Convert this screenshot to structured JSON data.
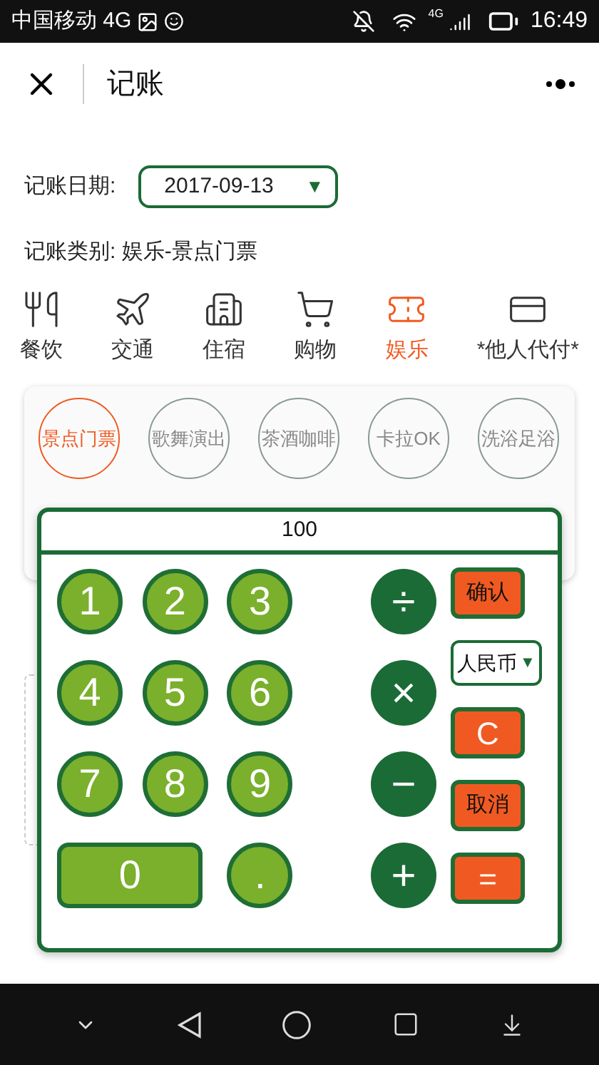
{
  "status_bar": {
    "carrier": "中国移动 4G",
    "network": "4G",
    "time": "16:49"
  },
  "header": {
    "title": "记账"
  },
  "date": {
    "label": "记账日期:",
    "value": "2017-09-13",
    "caret": "▼"
  },
  "category_line": "记账类别: 娱乐-景点门票",
  "categories": [
    {
      "label": "餐饮",
      "kind": "dining",
      "selected": false
    },
    {
      "label": "交通",
      "kind": "transport",
      "selected": false
    },
    {
      "label": "住宿",
      "kind": "hotel",
      "selected": false
    },
    {
      "label": "购物",
      "kind": "shopping",
      "selected": false
    },
    {
      "label": "娱乐",
      "kind": "ticket",
      "selected": true
    },
    {
      "label": "*他人代付*",
      "kind": "card",
      "selected": false
    }
  ],
  "subcategories": [
    {
      "label": "景点门票",
      "selected": true
    },
    {
      "label": "歌舞演出",
      "selected": false
    },
    {
      "label": "茶酒咖啡",
      "selected": false
    },
    {
      "label": "卡拉OK",
      "selected": false
    },
    {
      "label": "洗浴足浴",
      "selected": false
    }
  ],
  "calculator": {
    "display": "100",
    "digits": [
      {
        "label": "1",
        "kind": "digit"
      },
      {
        "label": "2",
        "kind": "digit"
      },
      {
        "label": "3",
        "kind": "digit"
      },
      {
        "label": "4",
        "kind": "digit"
      },
      {
        "label": "5",
        "kind": "digit"
      },
      {
        "label": "6",
        "kind": "digit"
      },
      {
        "label": "7",
        "kind": "digit"
      },
      {
        "label": "8",
        "kind": "digit"
      },
      {
        "label": "9",
        "kind": "digit"
      },
      {
        "label": "0",
        "kind": "zero"
      },
      {
        "label": ".",
        "kind": "digit"
      }
    ],
    "operators": [
      "÷",
      "×",
      "−",
      "+"
    ],
    "actions": [
      {
        "label": "确认",
        "kind": "button"
      },
      {
        "label": "人民币",
        "caret": "▼",
        "kind": "select"
      },
      {
        "label": "C",
        "kind": "button"
      },
      {
        "label": "取消",
        "kind": "button"
      },
      {
        "label": "=",
        "kind": "button"
      }
    ]
  }
}
